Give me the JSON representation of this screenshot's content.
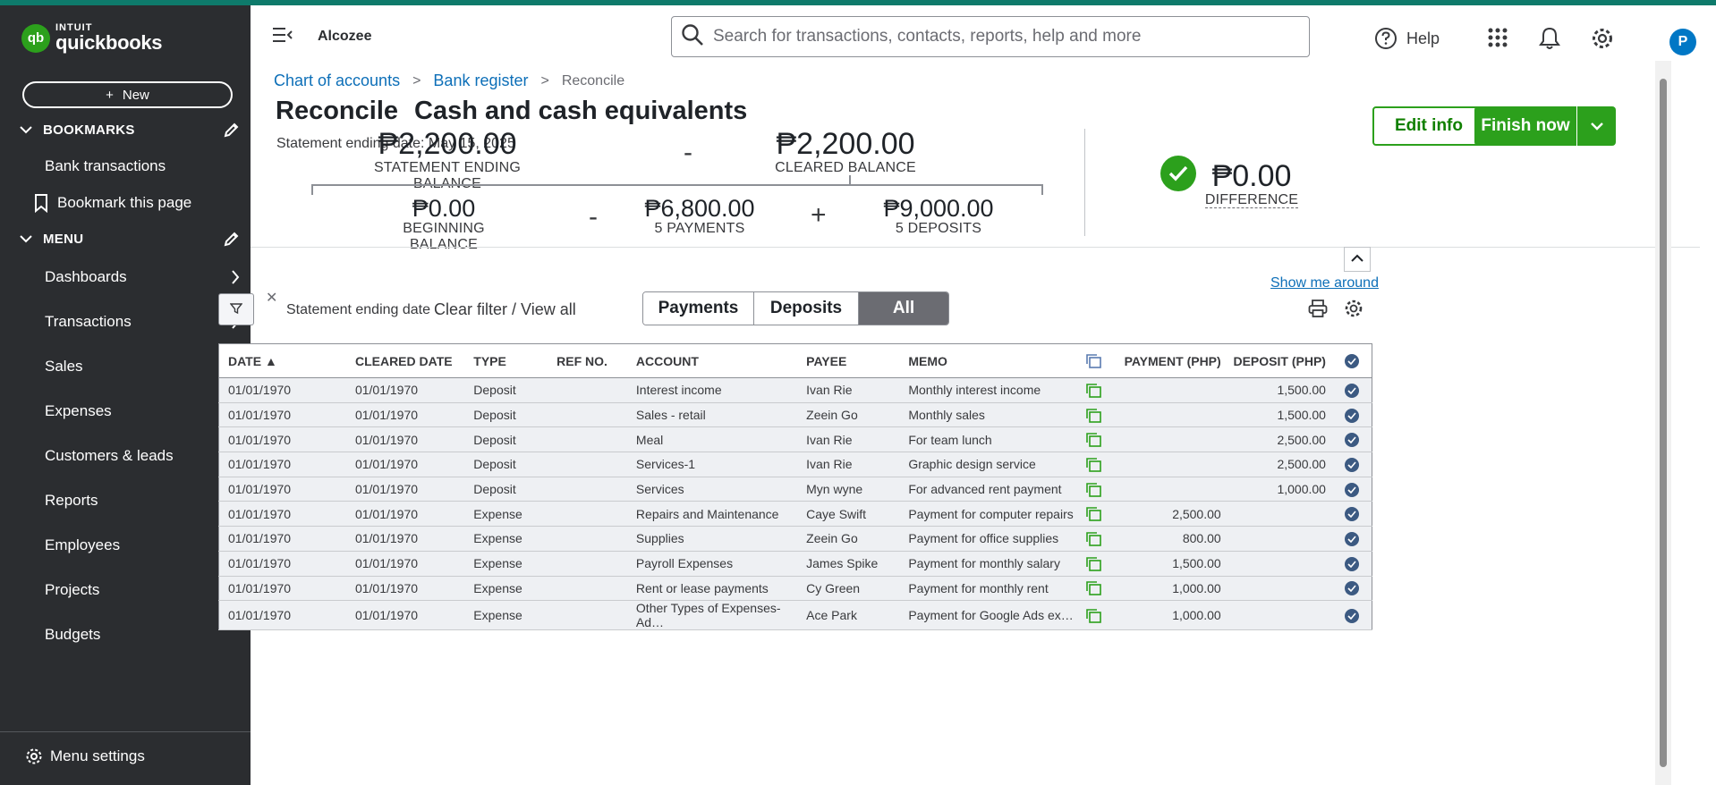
{
  "sidebar": {
    "brand_top": "INTUIT",
    "brand_bottom": "quickbooks",
    "new_label": "New",
    "bookmarks_title": "BOOKMARKS",
    "bookmarks": [
      "Bank transactions"
    ],
    "bookmark_page": "Bookmark this page",
    "menu_title": "MENU",
    "menu": [
      {
        "label": "Dashboards",
        "arrow": true
      },
      {
        "label": "Transactions",
        "arrow": true
      },
      {
        "label": "Sales",
        "arrow": true
      },
      {
        "label": "Expenses",
        "arrow": true
      },
      {
        "label": "Customers & leads",
        "arrow": true
      },
      {
        "label": "Reports",
        "arrow": true
      },
      {
        "label": "Employees",
        "arrow": false
      },
      {
        "label": "Projects",
        "arrow": false
      },
      {
        "label": "Budgets",
        "arrow": false
      }
    ],
    "menu_settings": "Menu settings"
  },
  "header": {
    "company": "Alcozee",
    "search_placeholder": "Search for transactions, contacts, reports, help and more",
    "help": "Help",
    "avatar": "P"
  },
  "breadcrumb": {
    "chart": "Chart of accounts",
    "register": "Bank register",
    "current": "Reconcile"
  },
  "page": {
    "title": "Reconcile",
    "account": "Cash and cash equivalents",
    "statement_date": "Statement ending date: May 15, 2025",
    "edit_info": "Edit info",
    "finish_now": "Finish now"
  },
  "summary": {
    "statement_ending_balance": "₱2,200.00",
    "statement_ending_label": "STATEMENT ENDING BALANCE",
    "minus": "-",
    "cleared_balance": "₱2,200.00",
    "cleared_label": "CLEARED BALANCE",
    "beginning_balance": "₱0.00",
    "beginning_label": "BEGINNING BALANCE",
    "payments": "₱6,800.00",
    "payments_label": "5 PAYMENTS",
    "plus": "+",
    "deposits": "₱9,000.00",
    "deposits_label": "5 DEPOSITS",
    "difference": "₱0.00",
    "difference_label": "DIFFERENCE"
  },
  "toolbar": {
    "show_me_around": "Show me around",
    "filter_close": "✕",
    "filter_label": "Statement ending date",
    "clear_filter": "Clear filter / View all",
    "tabs": [
      "Payments",
      "Deposits",
      "All"
    ],
    "active_tab": "All"
  },
  "table": {
    "columns": [
      "DATE ▲",
      "CLEARED DATE",
      "TYPE",
      "REF NO.",
      "ACCOUNT",
      "PAYEE",
      "MEMO",
      "",
      "PAYMENT (PHP)",
      "DEPOSIT (PHP)",
      ""
    ],
    "rows": [
      {
        "date": "01/01/1970",
        "cleared": "01/01/1970",
        "type": "Deposit",
        "ref": "",
        "account": "Interest income",
        "payee": "Ivan Rie",
        "memo": "Monthly interest income",
        "payment": "",
        "deposit": "1,500.00"
      },
      {
        "date": "01/01/1970",
        "cleared": "01/01/1970",
        "type": "Deposit",
        "ref": "",
        "account": "Sales - retail",
        "payee": "Zeein Go",
        "memo": "Monthly sales",
        "payment": "",
        "deposit": "1,500.00"
      },
      {
        "date": "01/01/1970",
        "cleared": "01/01/1970",
        "type": "Deposit",
        "ref": "",
        "account": "Meal",
        "payee": "Ivan Rie",
        "memo": "For team lunch",
        "payment": "",
        "deposit": "2,500.00"
      },
      {
        "date": "01/01/1970",
        "cleared": "01/01/1970",
        "type": "Deposit",
        "ref": "",
        "account": "Services-1",
        "payee": "Ivan Rie",
        "memo": "Graphic design service",
        "payment": "",
        "deposit": "2,500.00"
      },
      {
        "date": "01/01/1970",
        "cleared": "01/01/1970",
        "type": "Deposit",
        "ref": "",
        "account": "Services",
        "payee": "Myn wyne",
        "memo": "For advanced rent payment",
        "payment": "",
        "deposit": "1,000.00"
      },
      {
        "date": "01/01/1970",
        "cleared": "01/01/1970",
        "type": "Expense",
        "ref": "",
        "account": "Repairs and Maintenance",
        "payee": "Caye Swift",
        "memo": "Payment for computer repairs",
        "payment": "2,500.00",
        "deposit": ""
      },
      {
        "date": "01/01/1970",
        "cleared": "01/01/1970",
        "type": "Expense",
        "ref": "",
        "account": "Supplies",
        "payee": "Zeein Go",
        "memo": "Payment for office supplies",
        "payment": "800.00",
        "deposit": ""
      },
      {
        "date": "01/01/1970",
        "cleared": "01/01/1970",
        "type": "Expense",
        "ref": "",
        "account": "Payroll Expenses",
        "payee": "James Spike",
        "memo": "Payment for monthly salary",
        "payment": "1,500.00",
        "deposit": ""
      },
      {
        "date": "01/01/1970",
        "cleared": "01/01/1970",
        "type": "Expense",
        "ref": "",
        "account": "Rent or lease payments",
        "payee": "Cy Green",
        "memo": "Payment for monthly rent",
        "payment": "1,000.00",
        "deposit": ""
      },
      {
        "date": "01/01/1970",
        "cleared": "01/01/1970",
        "type": "Expense",
        "ref": "",
        "account": "Other Types of Expenses-Ad…",
        "payee": "Ace Park",
        "memo": "Payment for Google Ads ex…",
        "payment": "1,000.00",
        "deposit": ""
      }
    ]
  },
  "colors": {
    "brand_green": "#2ca01c",
    "link_blue": "#0d6fb8",
    "sidebar_bg": "#2b2d30",
    "check_blue": "#3c5a82"
  }
}
